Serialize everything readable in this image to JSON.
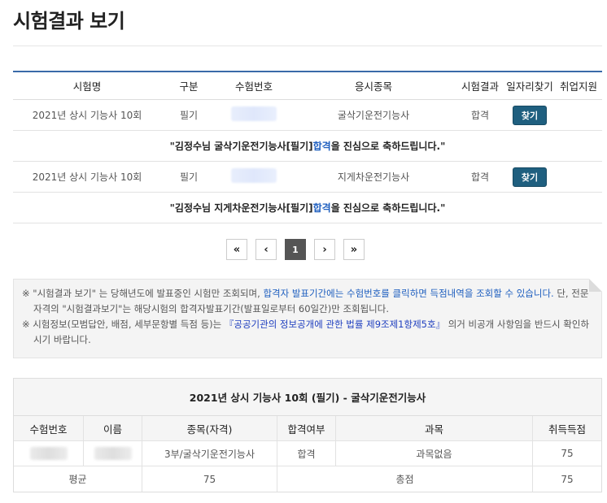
{
  "page": {
    "title": "시험결과 보기"
  },
  "results": {
    "headers": [
      "시험명",
      "구분",
      "수험번호",
      "응시종목",
      "시험결과",
      "일자리찾기",
      "취업지원"
    ],
    "rows": [
      {
        "exam": "2021년 상시 기능사 10회",
        "type": "필기",
        "field": "굴삭기운전기능사",
        "result": "합격",
        "button": "찾기",
        "msg_pre": "\"김정수님 굴삭기운전기능사[필기] ",
        "msg_pass": "합격",
        "msg_post": "을 진심으로 축하드립니다.\""
      },
      {
        "exam": "2021년 상시 기능사 10회",
        "type": "필기",
        "field": "지게차운전기능사",
        "result": "합격",
        "button": "찾기",
        "msg_pre": "\"김정수님 지게차운전기능사[필기] ",
        "msg_pass": "합격",
        "msg_post": "을 진심으로 축하드립니다.\""
      }
    ]
  },
  "pagination": {
    "first": "«",
    "prev": "‹",
    "current": "1",
    "next": "›",
    "last": "»"
  },
  "notice": {
    "l1_a": "※ \"시험결과 보기\" 는 당해년도에 발표중인 시험만 조회되며, ",
    "l1_b": "합격자 발표기간에는 수험번호를 클릭하면 득점내역을 조회할 수 있습니다.",
    "l1_c": " 단, 전문자격의 \"시험결과보기\"는 해당시험의 합격자발표기간(발표일로부터 60일간)만 조회됩니다.",
    "l2_a": "※ 시험정보(모범답안, 배점, 세부문항별 득점 등)는 ",
    "l2_b": "『공공기관의 정보공개에 관한 법률 제9조제1항제5호』",
    "l2_c": " 의거 비공개 사항임을 반드시 확인하시기 바랍니다."
  },
  "detail": {
    "title": "2021년 상시 기능사 10회 (필기) - 굴삭기운전기능사",
    "headers": [
      "수험번호",
      "이름",
      "종목(자격)",
      "합격여부",
      "과목",
      "취득득점"
    ],
    "row": {
      "item": "3부/굴삭기운전기능사",
      "status": "합격",
      "subject": "과목없음",
      "score": "75"
    },
    "avg_label": "평균",
    "avg_value": "75",
    "total_label": "총점",
    "total_value": "75"
  }
}
